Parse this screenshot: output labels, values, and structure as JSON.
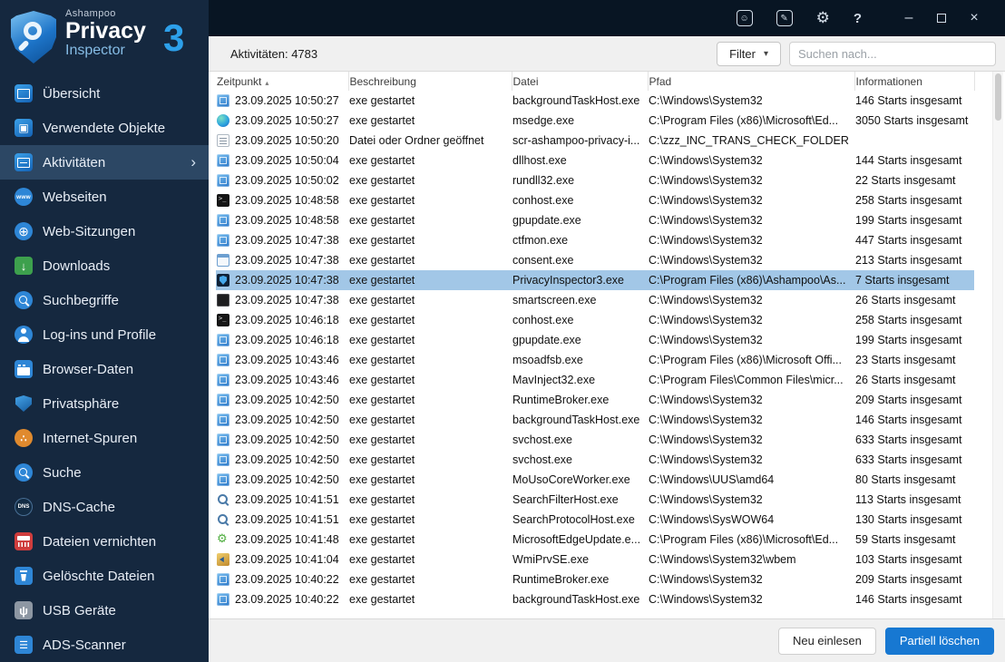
{
  "window": {
    "brand": "Ashampoo",
    "product_line1": "Privacy",
    "product_line2": "Inspector",
    "version": "3"
  },
  "topbar": {
    "icons": {
      "feedback": "☺",
      "survey": "✎",
      "settings": "⚙",
      "help": "?",
      "minimize": "–",
      "close": "×"
    }
  },
  "sidebar": {
    "active_chevron": "›",
    "items": [
      {
        "id": "uebersicht",
        "label": "Übersicht",
        "icon": "monitor-icon",
        "active": false
      },
      {
        "id": "verwendete-objekte",
        "label": "Verwendete Objekte",
        "icon": "objects-icon",
        "active": false
      },
      {
        "id": "aktivitaeten",
        "label": "Aktivitäten",
        "icon": "activity-monitor-icon",
        "active": true
      },
      {
        "id": "webseiten",
        "label": "Webseiten",
        "icon": "www-globe-icon",
        "active": false
      },
      {
        "id": "web-sitzungen",
        "label": "Web-Sitzungen",
        "icon": "globe-icon",
        "active": false
      },
      {
        "id": "downloads",
        "label": "Downloads",
        "icon": "download-icon",
        "active": false
      },
      {
        "id": "suchbegriffe",
        "label": "Suchbegriffe",
        "icon": "search-terms-icon",
        "active": false
      },
      {
        "id": "logins-und-profile",
        "label": "Log-ins und Profile",
        "icon": "user-icon",
        "active": false
      },
      {
        "id": "browser-daten",
        "label": "Browser-Daten",
        "icon": "browser-window-icon",
        "active": false
      },
      {
        "id": "privatsphaere",
        "label": "Privatsphäre",
        "icon": "shield-icon",
        "active": false
      },
      {
        "id": "internet-spuren",
        "label": "Internet-Spuren",
        "icon": "footprints-icon",
        "active": false
      },
      {
        "id": "suche",
        "label": "Suche",
        "icon": "web-search-icon",
        "active": false
      },
      {
        "id": "dns-cache",
        "label": "DNS-Cache",
        "icon": "dns-icon",
        "active": false
      },
      {
        "id": "dateien-vernichten",
        "label": "Dateien vernichten",
        "icon": "shredder-icon",
        "active": false
      },
      {
        "id": "geloeschte-dateien",
        "label": "Gelöschte Dateien",
        "icon": "trash-icon",
        "active": false
      },
      {
        "id": "usb-geraete",
        "label": "USB Geräte",
        "icon": "usb-icon",
        "active": false
      },
      {
        "id": "ads-scanner",
        "label": "ADS-Scanner",
        "icon": "ads-scanner-icon",
        "active": false
      }
    ]
  },
  "toolbar": {
    "count_label": "Aktivitäten: 4783",
    "filter_label": "Filter",
    "filter_caret": "▾",
    "search_placeholder": "Suchen nach..."
  },
  "table": {
    "sort_indicator": "▴",
    "columns": [
      {
        "id": "zeitpunkt",
        "label": "Zeitpunkt",
        "sorted": true
      },
      {
        "id": "beschreibung",
        "label": "Beschreibung",
        "sorted": false
      },
      {
        "id": "datei",
        "label": "Datei",
        "sorted": false
      },
      {
        "id": "pfad",
        "label": "Pfad",
        "sorted": false
      },
      {
        "id": "informationen",
        "label": "Informationen",
        "sorted": false
      }
    ],
    "rows": [
      {
        "icon": "app-window-icon",
        "time": "23.09.2025 10:50:27",
        "desc": "exe gestartet",
        "file": "backgroundTaskHost.exe",
        "path": "C:\\Windows\\System32",
        "info": "146 Starts insgesamt",
        "selected": false
      },
      {
        "icon": "edge-browser-icon",
        "time": "23.09.2025 10:50:27",
        "desc": "exe gestartet",
        "file": "msedge.exe",
        "path": "C:\\Program Files (x86)\\Microsoft\\Ed...",
        "info": "3050 Starts insgesamt",
        "selected": false
      },
      {
        "icon": "document-icon",
        "time": "23.09.2025 10:50:20",
        "desc": "Datei oder Ordner geöffnet",
        "file": "scr-ashampoo-privacy-i...",
        "path": "C:\\zzz_INC_TRANS_CHECK_FOLDER",
        "info": "",
        "selected": false
      },
      {
        "icon": "app-window-icon",
        "time": "23.09.2025 10:50:04",
        "desc": "exe gestartet",
        "file": "dllhost.exe",
        "path": "C:\\Windows\\System32",
        "info": "144 Starts insgesamt",
        "selected": false
      },
      {
        "icon": "app-window-icon",
        "time": "23.09.2025 10:50:02",
        "desc": "exe gestartet",
        "file": "rundll32.exe",
        "path": "C:\\Windows\\System32",
        "info": "22 Starts insgesamt",
        "selected": false
      },
      {
        "icon": "terminal-icon",
        "time": "23.09.2025 10:48:58",
        "desc": "exe gestartet",
        "file": "conhost.exe",
        "path": "C:\\Windows\\System32",
        "info": "258 Starts insgesamt",
        "selected": false
      },
      {
        "icon": "app-window-icon",
        "time": "23.09.2025 10:48:58",
        "desc": "exe gestartet",
        "file": "gpupdate.exe",
        "path": "C:\\Windows\\System32",
        "info": "199 Starts insgesamt",
        "selected": false
      },
      {
        "icon": "app-window-icon",
        "time": "23.09.2025 10:47:38",
        "desc": "exe gestartet",
        "file": "ctfmon.exe",
        "path": "C:\\Windows\\System32",
        "info": "447 Starts insgesamt",
        "selected": false
      },
      {
        "icon": "window-outline-icon",
        "time": "23.09.2025 10:47:38",
        "desc": "exe gestartet",
        "file": "consent.exe",
        "path": "C:\\Windows\\System32",
        "info": "213 Starts insgesamt",
        "selected": false
      },
      {
        "icon": "shield-icon",
        "time": "23.09.2025 10:47:38",
        "desc": "exe gestartet",
        "file": "PrivacyInspector3.exe",
        "path": "C:\\Program Files (x86)\\Ashampoo\\As...",
        "info": "7 Starts insgesamt",
        "selected": true
      },
      {
        "icon": "dark-app-icon",
        "time": "23.09.2025 10:47:38",
        "desc": "exe gestartet",
        "file": "smartscreen.exe",
        "path": "C:\\Windows\\System32",
        "info": "26 Starts insgesamt",
        "selected": false
      },
      {
        "icon": "terminal-icon",
        "time": "23.09.2025 10:46:18",
        "desc": "exe gestartet",
        "file": "conhost.exe",
        "path": "C:\\Windows\\System32",
        "info": "258 Starts insgesamt",
        "selected": false
      },
      {
        "icon": "app-window-icon",
        "time": "23.09.2025 10:46:18",
        "desc": "exe gestartet",
        "file": "gpupdate.exe",
        "path": "C:\\Windows\\System32",
        "info": "199 Starts insgesamt",
        "selected": false
      },
      {
        "icon": "app-window-icon",
        "time": "23.09.2025 10:43:46",
        "desc": "exe gestartet",
        "file": "msoadfsb.exe",
        "path": "C:\\Program Files (x86)\\Microsoft Offi...",
        "info": "23 Starts insgesamt",
        "selected": false
      },
      {
        "icon": "app-window-icon",
        "time": "23.09.2025 10:43:46",
        "desc": "exe gestartet",
        "file": "MavInject32.exe",
        "path": "C:\\Program Files\\Common Files\\micr...",
        "info": "26 Starts insgesamt",
        "selected": false
      },
      {
        "icon": "app-window-icon",
        "time": "23.09.2025 10:42:50",
        "desc": "exe gestartet",
        "file": "RuntimeBroker.exe",
        "path": "C:\\Windows\\System32",
        "info": "209 Starts insgesamt",
        "selected": false
      },
      {
        "icon": "app-window-icon",
        "time": "23.09.2025 10:42:50",
        "desc": "exe gestartet",
        "file": "backgroundTaskHost.exe",
        "path": "C:\\Windows\\System32",
        "info": "146 Starts insgesamt",
        "selected": false
      },
      {
        "icon": "app-window-icon",
        "time": "23.09.2025 10:42:50",
        "desc": "exe gestartet",
        "file": "svchost.exe",
        "path": "C:\\Windows\\System32",
        "info": "633 Starts insgesamt",
        "selected": false
      },
      {
        "icon": "app-window-icon",
        "time": "23.09.2025 10:42:50",
        "desc": "exe gestartet",
        "file": "svchost.exe",
        "path": "C:\\Windows\\System32",
        "info": "633 Starts insgesamt",
        "selected": false
      },
      {
        "icon": "app-window-icon",
        "time": "23.09.2025 10:42:50",
        "desc": "exe gestartet",
        "file": "MoUsoCoreWorker.exe",
        "path": "C:\\Windows\\UUS\\amd64",
        "info": "80 Starts insgesamt",
        "selected": false
      },
      {
        "icon": "search-icon",
        "time": "23.09.2025 10:41:51",
        "desc": "exe gestartet",
        "file": "SearchFilterHost.exe",
        "path": "C:\\Windows\\System32",
        "info": "113 Starts insgesamt",
        "selected": false
      },
      {
        "icon": "search-icon",
        "time": "23.09.2025 10:41:51",
        "desc": "exe gestartet",
        "file": "SearchProtocolHost.exe",
        "path": "C:\\Windows\\SysWOW64",
        "info": "130 Starts insgesamt",
        "selected": false
      },
      {
        "icon": "gear-icon",
        "time": "23.09.2025 10:41:48",
        "desc": "exe gestartet",
        "file": "MicrosoftEdgeUpdate.e...",
        "path": "C:\\Program Files (x86)\\Microsoft\\Ed...",
        "info": "59 Starts insgesamt",
        "selected": false
      },
      {
        "icon": "wmi-icon",
        "time": "23.09.2025 10:41:04",
        "desc": "exe gestartet",
        "file": "WmiPrvSE.exe",
        "path": "C:\\Windows\\System32\\wbem",
        "info": "103 Starts insgesamt",
        "selected": false
      },
      {
        "icon": "app-window-icon",
        "time": "23.09.2025 10:40:22",
        "desc": "exe gestartet",
        "file": "RuntimeBroker.exe",
        "path": "C:\\Windows\\System32",
        "info": "209 Starts insgesamt",
        "selected": false
      },
      {
        "icon": "app-window-icon",
        "time": "23.09.2025 10:40:22",
        "desc": "exe gestartet",
        "file": "backgroundTaskHost.exe",
        "path": "C:\\Windows\\System32",
        "info": "146 Starts insgesamt",
        "selected": false
      }
    ]
  },
  "footer": {
    "reload_label": "Neu einlesen",
    "partial_delete_label": "Partiell löschen"
  },
  "colors": {
    "accent": "#1778d2",
    "selected_row": "#a2c7e7",
    "sidebar_bg": "#15283f",
    "topbar_bg": "#081523"
  }
}
